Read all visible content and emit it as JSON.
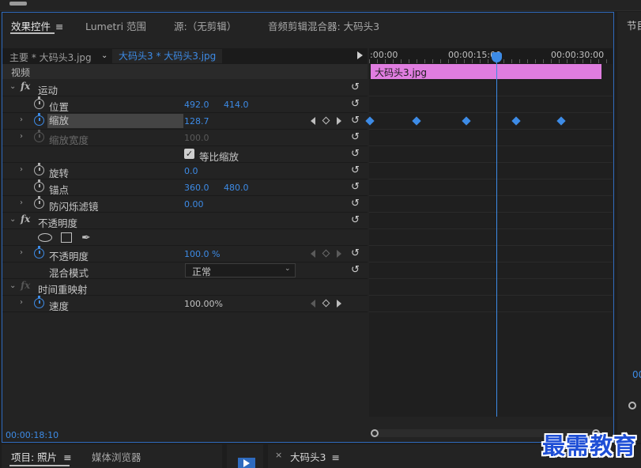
{
  "panel_tabs": {
    "effect_controls": "效果控件",
    "menu_glyph": "≡",
    "lumetri": "Lumetri 范围",
    "source": "源:（无剪辑）",
    "audio_mixer": "音频剪辑混合器: 大码头3",
    "right_tab": "节目"
  },
  "subtabs": {
    "master": "主要 * 大码头3.jpg",
    "caret": "⌄",
    "clip": "大码头3 * 大码头3.jpg"
  },
  "section_video": "视频",
  "effects": {
    "motion": {
      "fx": "fx",
      "name": "运动",
      "position": {
        "label": "位置",
        "x": "492.0",
        "y": "414.0"
      },
      "scale": {
        "label": "缩放",
        "value": "128.7"
      },
      "scale_width": {
        "label": "缩放宽度",
        "value": "100.0"
      },
      "uniform_scale": {
        "label": "等比缩放",
        "checked": true
      },
      "rotation": {
        "label": "旋转",
        "value": "0.0"
      },
      "anchor": {
        "label": "锚点",
        "x": "360.0",
        "y": "480.0"
      },
      "anti_flicker": {
        "label": "防闪烁滤镜",
        "value": "0.00"
      }
    },
    "opacity": {
      "fx": "fx",
      "name": "不透明度",
      "opacity": {
        "label": "不透明度",
        "value": "100.0 %"
      },
      "blend_mode": {
        "label": "混合模式",
        "value": "正常"
      }
    },
    "time_remap": {
      "fx": "fx",
      "name": "时间重映射",
      "speed": {
        "label": "速度",
        "value": "100.00%"
      }
    }
  },
  "timeline": {
    "timecodes": [
      ":00:00",
      "00:00:15:00",
      "00:00:30:00"
    ],
    "clip_name": "大码头3.jpg",
    "keyframes_scale": [
      0.0,
      0.2,
      0.41,
      0.62,
      0.81
    ]
  },
  "current_time": "00:00:18:10",
  "right_panel_tc": "00",
  "bottom": {
    "project_tab": "项目: 照片",
    "media_browser": "媒体浏览器",
    "close": "×",
    "sequence_tab": "大码头3"
  },
  "watermark": "最需教育",
  "colors": {
    "accent": "#3d8be6",
    "clip": "#e07de0",
    "panel_border": "#2f6bbf"
  }
}
